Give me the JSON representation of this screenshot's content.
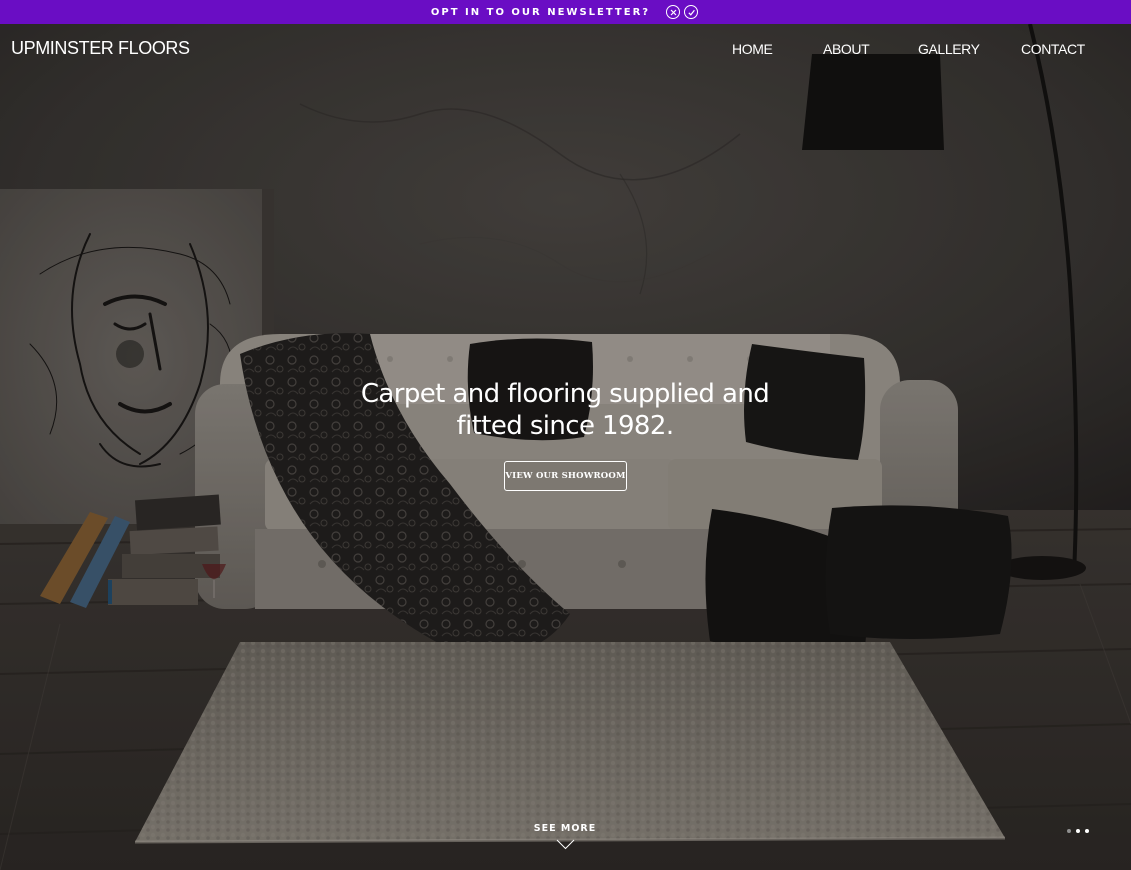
{
  "newsletter": {
    "text": "OPT IN TO OUR NEWSLETTER?",
    "background": "#6a0dc4",
    "decline_icon": "close-circle-icon",
    "accept_icon": "check-circle-icon"
  },
  "header": {
    "brand": "UPMINSTER FLOORS",
    "nav": [
      {
        "label": "HOME"
      },
      {
        "label": "ABOUT"
      },
      {
        "label": "GALLERY"
      },
      {
        "label": "CONTACT"
      }
    ]
  },
  "hero": {
    "headline_line1": "Carpet and flooring supplied and",
    "headline_line2": "fitted since 1982.",
    "cta_label": "VIEW OUR SHOWROOM",
    "see_more": "SEE MORE",
    "slide_count": 3,
    "active_slide": 2
  }
}
